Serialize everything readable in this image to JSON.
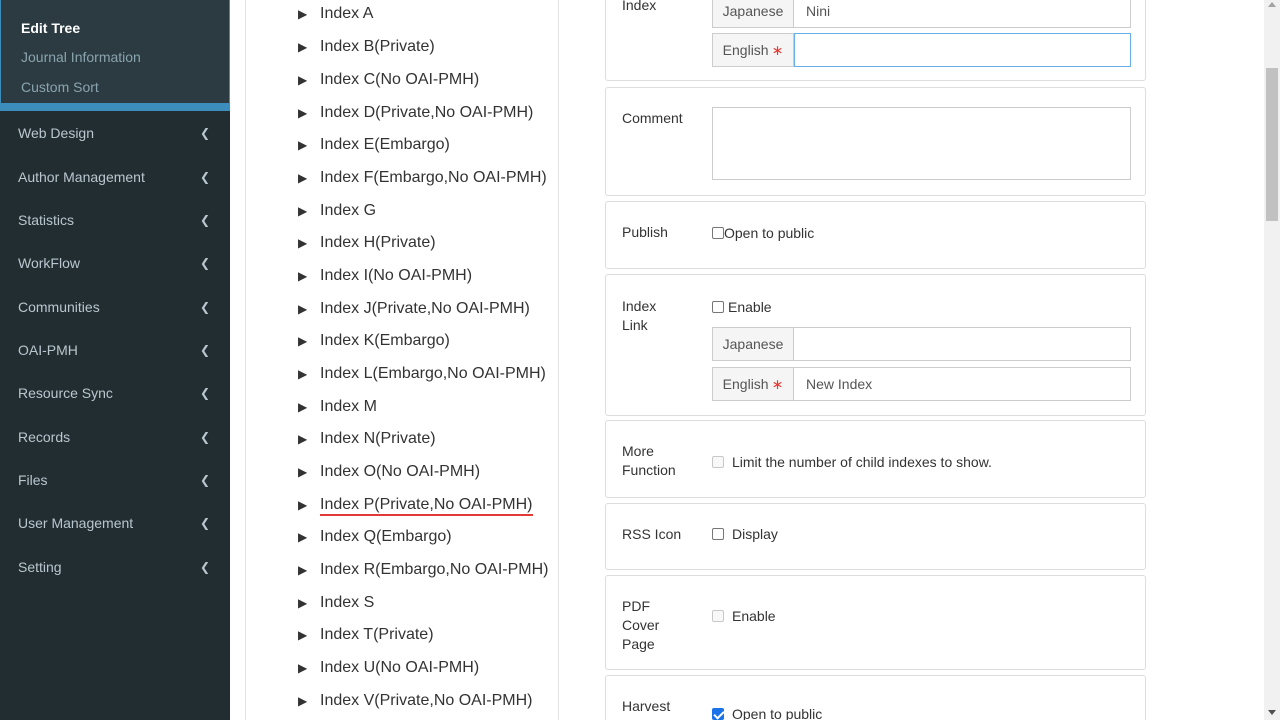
{
  "sidebar": {
    "submenu": [
      "Edit Tree",
      "Journal Information",
      "Custom Sort"
    ],
    "menu": [
      "Web Design",
      "Author Management",
      "Statistics",
      "WorkFlow",
      "Communities",
      "OAI-PMH",
      "Resource Sync",
      "Records",
      "Files",
      "User Management",
      "Setting"
    ]
  },
  "tree": {
    "items": [
      "Index A",
      "Index B(Private)",
      "Index C(No OAI-PMH)",
      "Index D(Private,No OAI-PMH)",
      "Index E(Embargo)",
      "Index F(Embargo,No OAI-PMH)",
      "Index G",
      "Index H(Private)",
      "Index I(No OAI-PMH)",
      "Index J(Private,No OAI-PMH)",
      "Index K(Embargo)",
      "Index L(Embargo,No OAI-PMH)",
      "Index M",
      "Index N(Private)",
      "Index O(No OAI-PMH)",
      "Index P(Private,No OAI-PMH)",
      "Index Q(Embargo)",
      "Index R(Embargo,No OAI-PMH)",
      "Index S",
      "Index T(Private)",
      "Index U(No OAI-PMH)",
      "Index V(Private,No OAI-PMH)"
    ],
    "selected": "Index P(Private,No OAI-PMH)"
  },
  "form": {
    "index": {
      "label": "Index",
      "japanese_label": "Japanese",
      "japanese_value": "Nini",
      "english_label": "English",
      "english_value": ""
    },
    "comment": {
      "label": "Comment",
      "value": ""
    },
    "publish": {
      "label": "Publish",
      "checkbox": "Open to public",
      "checked": false
    },
    "index_link": {
      "label_line1": "Index",
      "label_line2": "Link",
      "enable": "Enable",
      "japanese_label": "Japanese",
      "japanese_value": "",
      "english_label": "English",
      "english_value": "New Index"
    },
    "more_function": {
      "label_line1": "More",
      "label_line2": "Function",
      "checkbox": "Limit the number of child indexes to show."
    },
    "rss_icon": {
      "label": "RSS Icon",
      "checkbox": "Display"
    },
    "pdf_cover": {
      "label_line1": "PDF",
      "label_line2": "Cover",
      "label_line3": "Page",
      "checkbox": "Enable"
    },
    "harvest": {
      "label": "Harvest",
      "checkbox": "Open to public",
      "checked": true
    },
    "required_mark": "∗"
  },
  "icons": {
    "chevron": "chevron-left-icon",
    "tree_toggle": "triangle-right-icon"
  },
  "colors": {
    "sidebar_bg": "#222d32",
    "accent": "#3c8dbc",
    "required": "#e53935",
    "selected_underline": "#e53935"
  }
}
